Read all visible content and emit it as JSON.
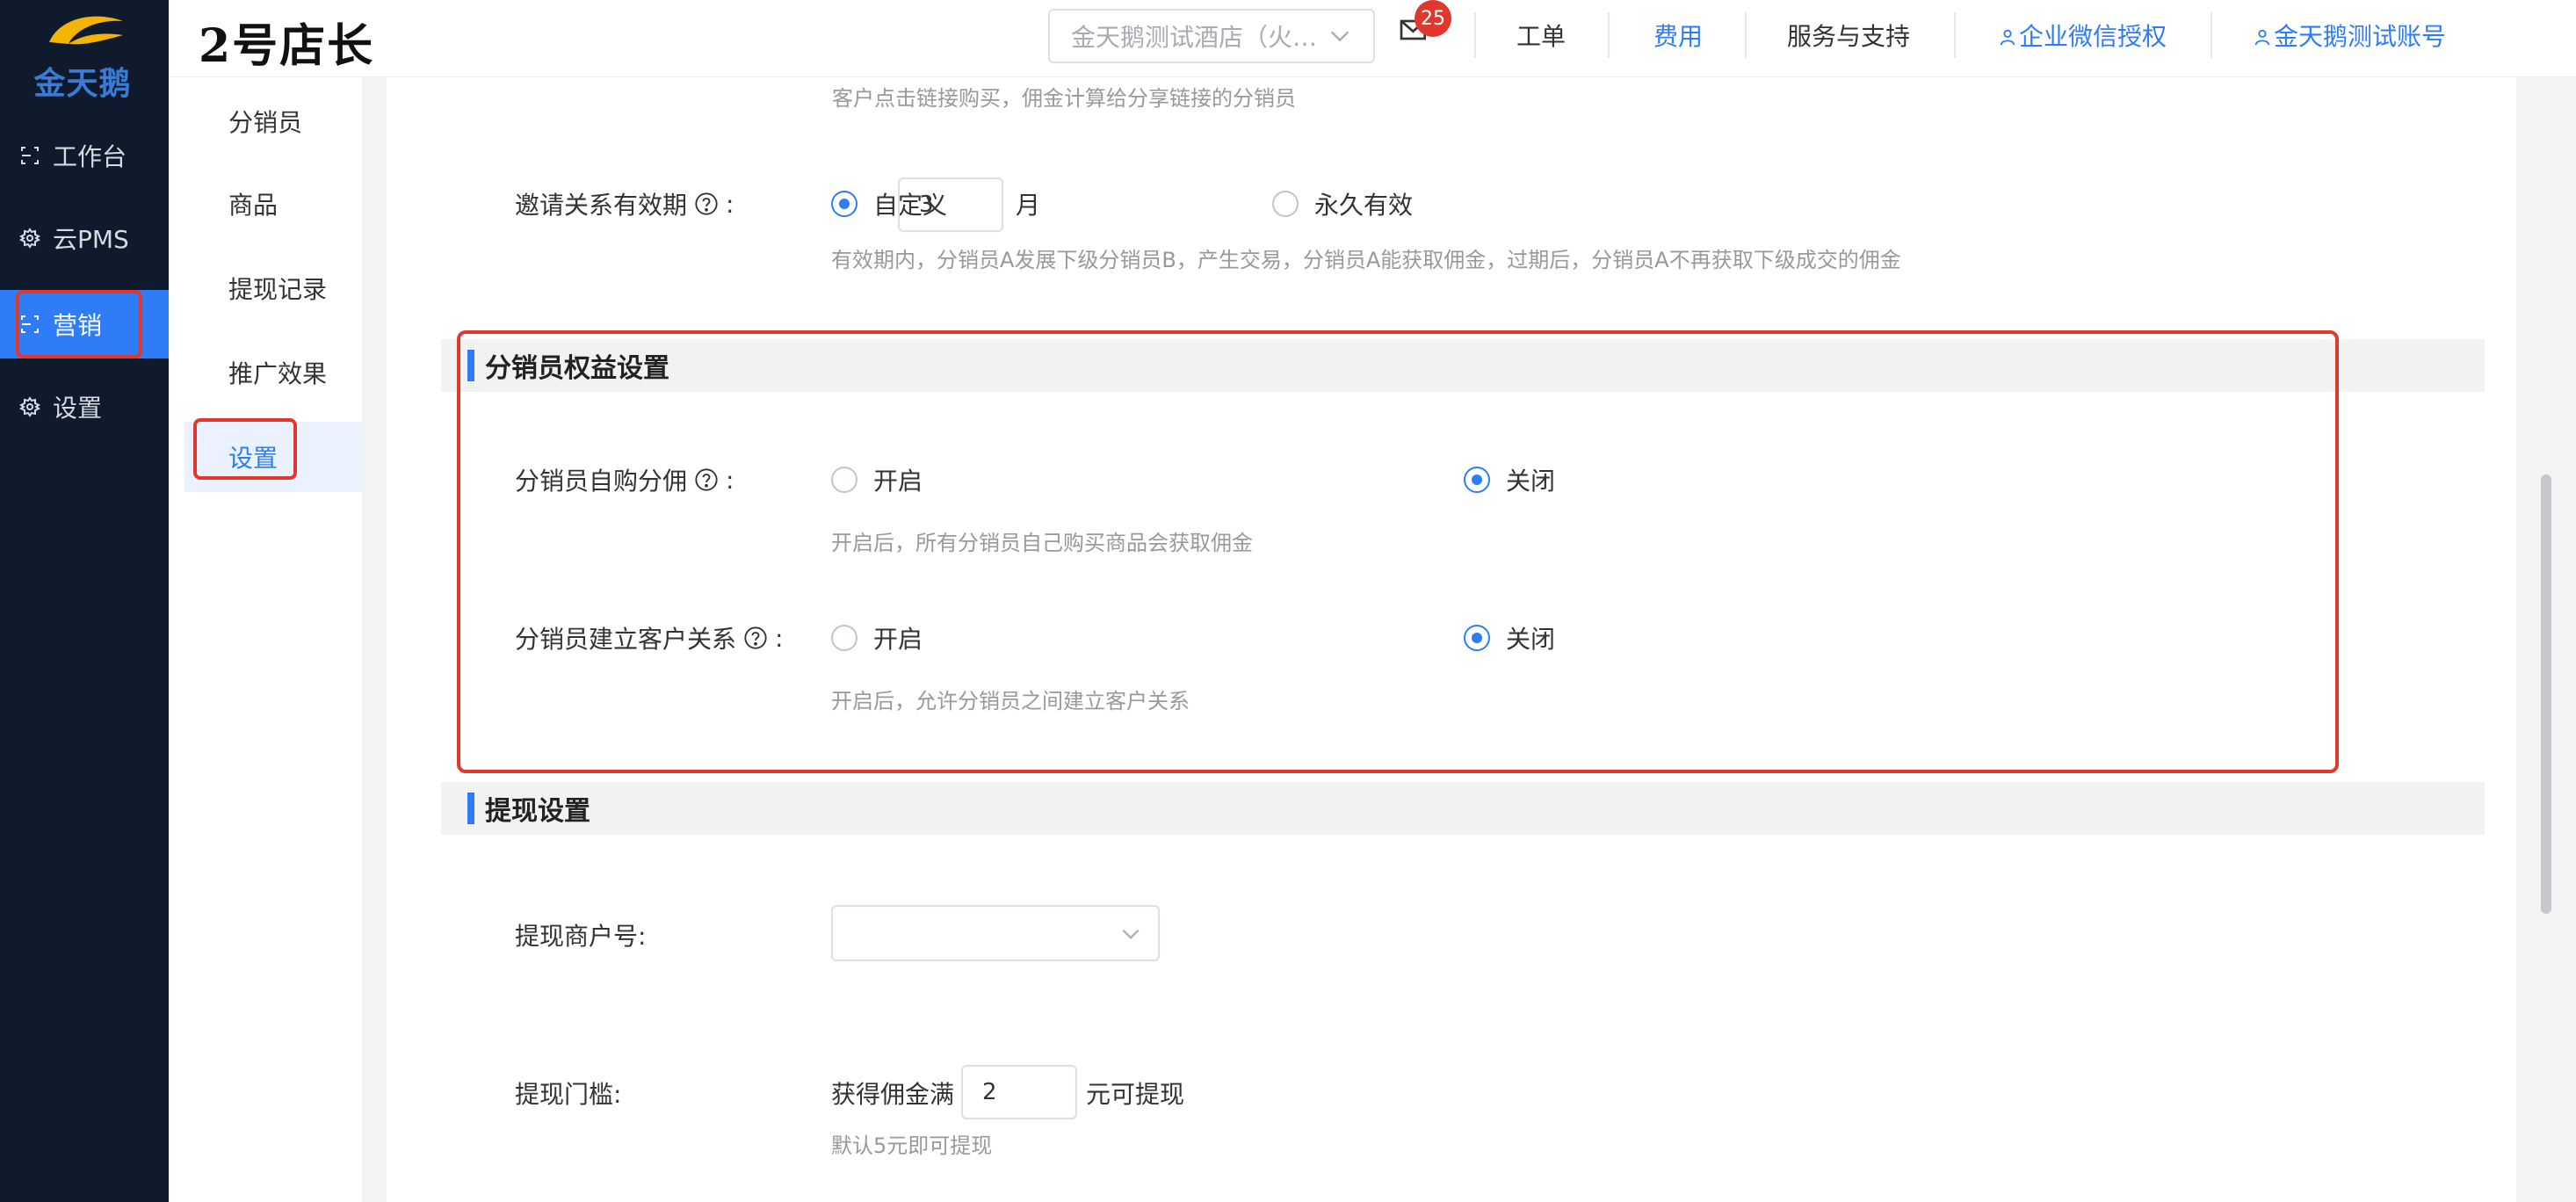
{
  "app": {
    "logo_text": "金天鹅",
    "brand": "2号店长"
  },
  "sidebar": {
    "items": [
      {
        "label": "工作台",
        "icon": "workbench-icon"
      },
      {
        "label": "云PMS",
        "icon": "gear-icon"
      },
      {
        "label": "营销",
        "icon": "marketing-icon",
        "active": true
      },
      {
        "label": "设置",
        "icon": "gear-icon"
      }
    ]
  },
  "header": {
    "hotel_select": "金天鹅测试酒店（火…",
    "mail_badge": "25",
    "links": {
      "ticket": "工单",
      "fee": "费用",
      "support": "服务与支持",
      "wechat_auth": "企业微信授权",
      "account": "金天鹅测试账号"
    }
  },
  "subnav": {
    "items": [
      {
        "label": "分销员"
      },
      {
        "label": "商品"
      },
      {
        "label": "提现记录"
      },
      {
        "label": "推广效果"
      },
      {
        "label": "设置",
        "active": true
      }
    ]
  },
  "content": {
    "cut_top_text": "客户点击链接购买，佣金计算给分享链接的分销员",
    "invite": {
      "label": "邀请关系有效期",
      "colon": ":",
      "custom_label": "自定义",
      "custom_value": "3",
      "unit": "月",
      "forever_label": "永久有效",
      "hint": "有效期内，分销员A发展下级分销员B，产生交易，分销员A能获取佣金，过期后，分销员A不再获取下级成交的佣金"
    },
    "rights_section": {
      "title": "分销员权益设置",
      "self_purchase": {
        "label": "分销员自购分佣",
        "on_label": "开启",
        "off_label": "关闭",
        "selected": "off",
        "hint": "开启后，所有分销员自己购买商品会获取佣金"
      },
      "customer_relation": {
        "label": "分销员建立客户关系",
        "on_label": "开启",
        "off_label": "关闭",
        "selected": "off",
        "hint": "开启后，允许分销员之间建立客户关系"
      }
    },
    "withdraw_section": {
      "title": "提现设置",
      "merchant_label": "提现商户号:",
      "merchant_value": "",
      "threshold_label": "提现门槛:",
      "threshold_prefix": "获得佣金满",
      "threshold_value": "2",
      "threshold_suffix": "元可提现",
      "threshold_hint": "默认5元即可提现"
    }
  },
  "colors": {
    "sidebar_bg": "#0f1a2d",
    "accent": "#2e7cf6",
    "highlight_red": "#e0382c"
  }
}
